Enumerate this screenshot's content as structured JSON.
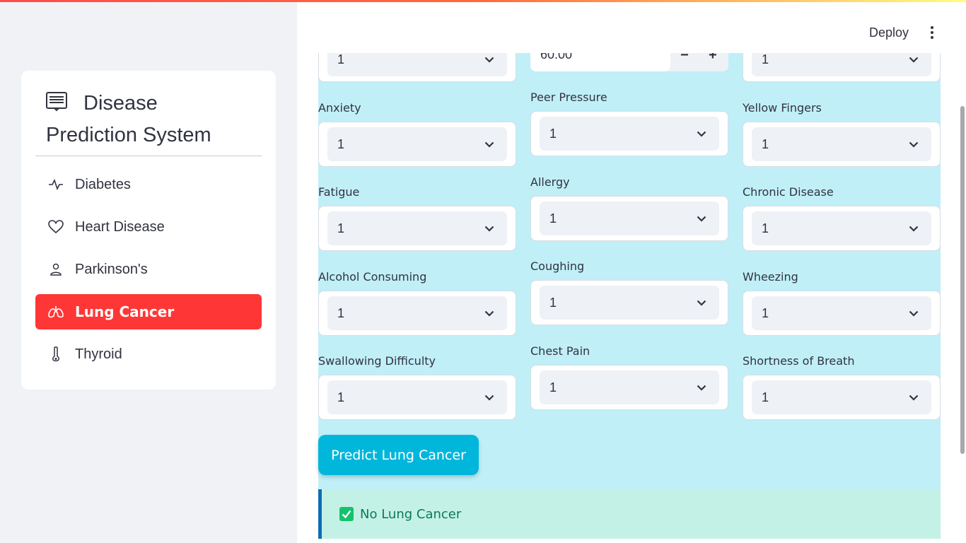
{
  "header": {
    "deploy_label": "Deploy"
  },
  "sidebar": {
    "title": "Disease Prediction System",
    "title_line1": "Disease",
    "title_line2": "Prediction System",
    "items": [
      {
        "label": "Diabetes",
        "icon": "activity-icon",
        "active": false
      },
      {
        "label": "Heart Disease",
        "icon": "heart-icon",
        "active": false
      },
      {
        "label": "Parkinson's",
        "icon": "person-icon",
        "active": false
      },
      {
        "label": "Lung Cancer",
        "icon": "lungs-icon",
        "active": true
      },
      {
        "label": "Thyroid",
        "icon": "thermometer-icon",
        "active": false
      }
    ],
    "active_color": "#ff3636"
  },
  "form": {
    "partial_top_row": {
      "left_value": "1",
      "middle_number_value": "60.00",
      "right_value": "1",
      "minus": "−",
      "plus": "+"
    },
    "fields": [
      {
        "label": "Anxiety",
        "value": "1"
      },
      {
        "label": "Peer Pressure",
        "value": "1"
      },
      {
        "label": "Yellow Fingers",
        "value": "1"
      },
      {
        "label": "Fatigue",
        "value": "1"
      },
      {
        "label": "Allergy",
        "value": "1"
      },
      {
        "label": "Chronic Disease",
        "value": "1"
      },
      {
        "label": "Alcohol Consuming",
        "value": "1"
      },
      {
        "label": "Coughing",
        "value": "1"
      },
      {
        "label": "Wheezing",
        "value": "1"
      },
      {
        "label": "Swallowing Difficulty",
        "value": "1"
      },
      {
        "label": "Chest Pain",
        "value": "1"
      },
      {
        "label": "Shortness of Breath",
        "value": "1"
      }
    ],
    "predict_button": "Predict Lung Cancer",
    "result": "No Lung Cancer"
  },
  "colors": {
    "main_background": "#c0eff8",
    "button": "#00b7db",
    "success_bg": "#c4f1e6",
    "success_text": "#0b7a53"
  }
}
